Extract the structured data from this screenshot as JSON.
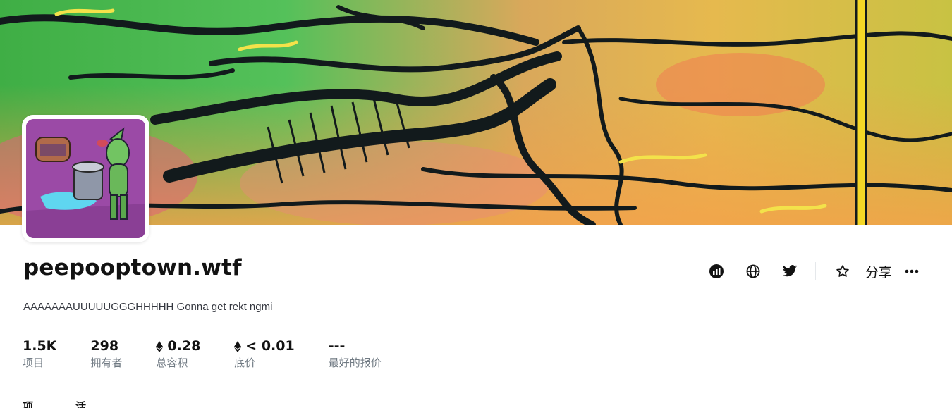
{
  "collection": {
    "name": "peepooptown.wtf",
    "description": "AAAAAAAUUUUUGGGHHHHH Gonna get rekt ngmi"
  },
  "stats": [
    {
      "value": "1.5K",
      "label": "项目",
      "eth": false
    },
    {
      "value": "298",
      "label": "拥有者",
      "eth": false
    },
    {
      "value": "0.28",
      "label": "总容积",
      "eth": true
    },
    {
      "value": "< 0.01",
      "label": "底价",
      "eth": true
    },
    {
      "value": "---",
      "label": "最好的报价",
      "eth": false
    }
  ],
  "actions": {
    "icons": [
      "activity-chart-icon",
      "globe-icon",
      "twitter-icon",
      "star-icon",
      "more-icon"
    ],
    "share_label": "分享"
  },
  "tabs": [
    {
      "label": "项"
    },
    {
      "label": "活"
    }
  ],
  "colors": {
    "text_primary": "#121212",
    "text_secondary": "#707a83",
    "avatar_bg": "#9b4aa6"
  }
}
